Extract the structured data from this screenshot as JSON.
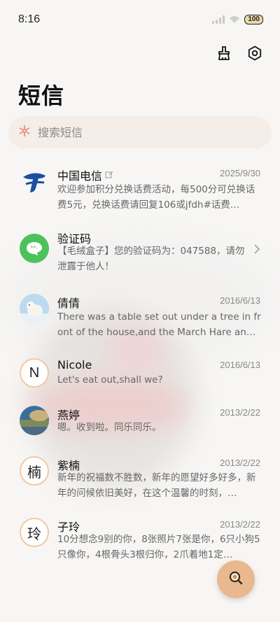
{
  "status_bar": {
    "time": "8:16",
    "battery": "100"
  },
  "header": {
    "title": "短信"
  },
  "search": {
    "placeholder": "搜索短信"
  },
  "messages": [
    {
      "sender": "中国电信",
      "date": "2025/9/30",
      "preview": "欢迎参加积分兑换话费活动，每500分可兑换话费5元，兑换话费请回复106或jfdh#话费…",
      "avatar": "china-telecom-logo"
    },
    {
      "sender": "验证码",
      "date": "",
      "preview": "【毛绒盒子】您的验证码为：047588，请勿泄露于他人！",
      "avatar": "verification-code-icon"
    },
    {
      "sender": "倩倩",
      "date": "2016/6/13",
      "preview": "There was a table set out under a tree in front of the house,and the March Hare an…",
      "avatar": "polar-bear-photo"
    },
    {
      "sender": "Nicole",
      "date": "2016/6/13",
      "preview": "Let's eat out,shall we?",
      "avatar_letter": "N"
    },
    {
      "sender": "燕婷",
      "date": "2013/2/22",
      "preview": "嗯。收到啦。同乐同乐。",
      "avatar": "landscape-photo"
    },
    {
      "sender": "紫楠",
      "date": "2013/2/22",
      "preview": "新年的祝福数不胜数，新年的愿望好多好多，新年的问候依旧美好，在这个温馨的时刻，…",
      "avatar_letter": "楠"
    },
    {
      "sender": "子玲",
      "date": "2013/2/22",
      "preview": "10分想念9别的你，8张照片7张是你，6只小狗5只像你，4根骨头3根归你，2爪着地1定…",
      "avatar_letter": "玲"
    }
  ],
  "colors": {
    "accent": "#eab88f",
    "search_bg": "#f4ede8",
    "telecom_blue": "#1a4fa3",
    "code_green": "#4cc35a"
  }
}
